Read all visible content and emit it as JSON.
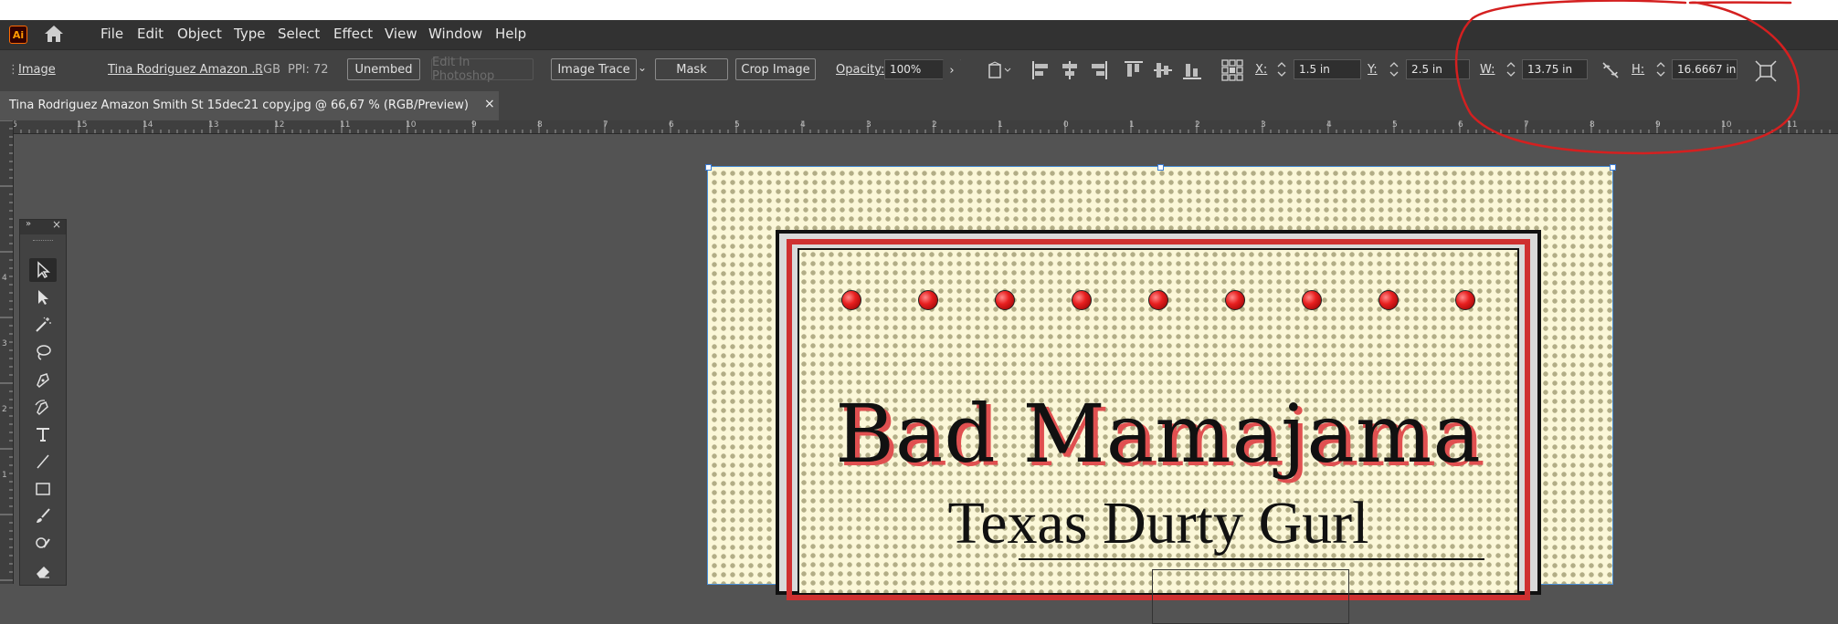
{
  "app": {
    "logo_text": "Ai"
  },
  "menu": [
    "File",
    "Edit",
    "Object",
    "Type",
    "Select",
    "Effect",
    "View",
    "Window",
    "Help"
  ],
  "control_bar": {
    "object_type": "Image",
    "file_name": "Tina Rodriguez Amazon ...",
    "color_mode": "RGB",
    "ppi": "PPI: 72",
    "unembed": "Unembed",
    "edit_in_photoshop": "Edit In Photoshop",
    "image_trace": "Image Trace",
    "mask": "Mask",
    "crop_image": "Crop Image",
    "opacity_label": "Opacity:",
    "opacity_value": "100%",
    "x_label": "X:",
    "x_value": "1.5 in",
    "y_label": "Y:",
    "y_value": "2.5 in",
    "w_label": "W:",
    "w_value": "13.75 in",
    "h_label": "H:",
    "h_value": "16.6667 in"
  },
  "document_tab": {
    "title": "Tina Rodriguez Amazon Smith St 15dec21 copy.jpg @ 66,67 % (RGB/Preview)",
    "close": "×"
  },
  "ruler_top": [
    "6",
    "15",
    "14",
    "13",
    "12",
    "11",
    "10",
    "9",
    "8",
    "7",
    "6",
    "5",
    "4",
    "3",
    "2",
    "1",
    "0",
    "1",
    "2",
    "3",
    "4",
    "5",
    "6",
    "7",
    "8",
    "9",
    "10",
    "11"
  ],
  "ruler_left": [
    "4",
    "3",
    "2",
    "1"
  ],
  "artwork": {
    "title": "Bad Mamajama",
    "subtitle": "Texas Durty Gurl",
    "accent_red": "#cf3030",
    "background": "#fbf7d8"
  },
  "annotation_color": "#d42020"
}
